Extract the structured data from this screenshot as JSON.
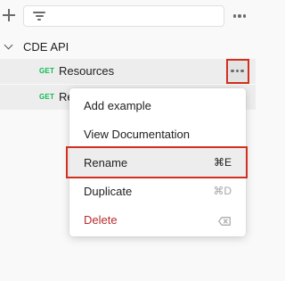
{
  "toolbar": {
    "add_icon": "plus-icon",
    "filter_icon": "filter-icon",
    "more_icon": "more-horizontal-icon"
  },
  "collection": {
    "name": "CDE API",
    "expanded_icon": "chevron-down-icon"
  },
  "requests": [
    {
      "method": "GET",
      "name": "Resources"
    },
    {
      "method": "GET",
      "name": "Re"
    }
  ],
  "menu": {
    "items": [
      {
        "label": "Add example",
        "shortcut": ""
      },
      {
        "label": "View Documentation",
        "shortcut": ""
      },
      {
        "label": "Rename",
        "shortcut": "⌘E"
      },
      {
        "label": "Duplicate",
        "shortcut": "⌘D"
      },
      {
        "label": "Delete",
        "shortcut_icon": "backspace-icon"
      }
    ]
  },
  "colors": {
    "get_method": "#0cbb52",
    "highlight_border": "#d0301d",
    "delete_text": "#b72d2d",
    "selected_row": "#ededed"
  }
}
